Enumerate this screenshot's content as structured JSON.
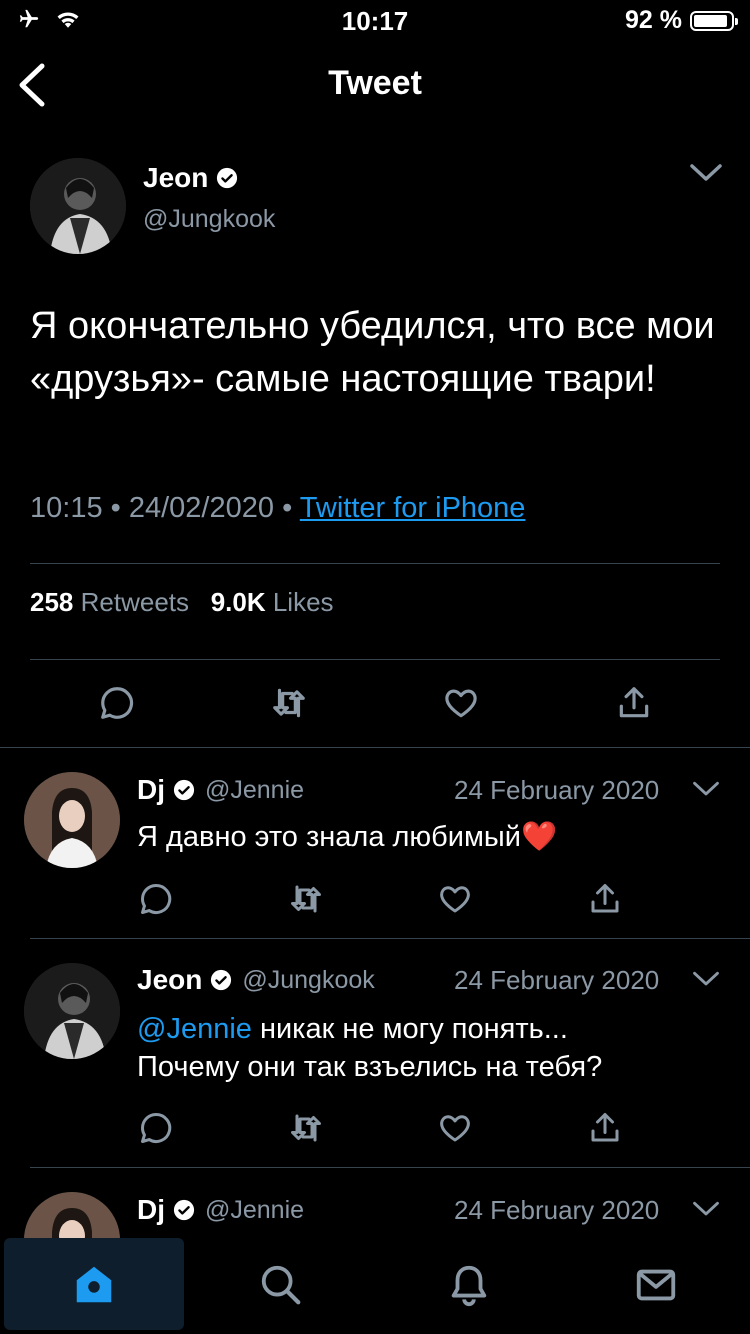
{
  "status_bar": {
    "time": "10:17",
    "battery": "92 %",
    "battery_level": 0.92
  },
  "header": {
    "title": "Tweet"
  },
  "main_tweet": {
    "author_name": "Jeon",
    "author_handle": "@Jungkook",
    "text": "Я окончательно убедился, что все мои «друзья»- самые настоящие твари!",
    "time": "10:15",
    "date": "24/02/2020",
    "source": "Twitter for iPhone",
    "retweets_count": "258",
    "retweets_label": "Retweets",
    "likes_count": "9.0K",
    "likes_label": "Likes"
  },
  "replies": [
    {
      "author_name": "Dj",
      "author_handle": "@Jennie",
      "date": "24 February 2020",
      "mention": "",
      "text": "Я давно это знала любимый❤️"
    },
    {
      "author_name": "Jeon",
      "author_handle": "@Jungkook",
      "date": "24 February 2020",
      "mention": "@Jennie",
      "text_line1": " никак не могу понять...",
      "text_line2": "Почему они так взъелись на тебя?"
    },
    {
      "author_name": "Dj",
      "author_handle": "@Jennie",
      "date": "24 February 2020"
    }
  ],
  "colors": {
    "accent": "#1d9bf0",
    "muted": "#8b98a5",
    "separator": "#38444d",
    "background": "#000000"
  },
  "tabbar": {
    "items": [
      "home-icon",
      "search-icon",
      "notifications-icon",
      "messages-icon"
    ],
    "active": "home-icon"
  }
}
